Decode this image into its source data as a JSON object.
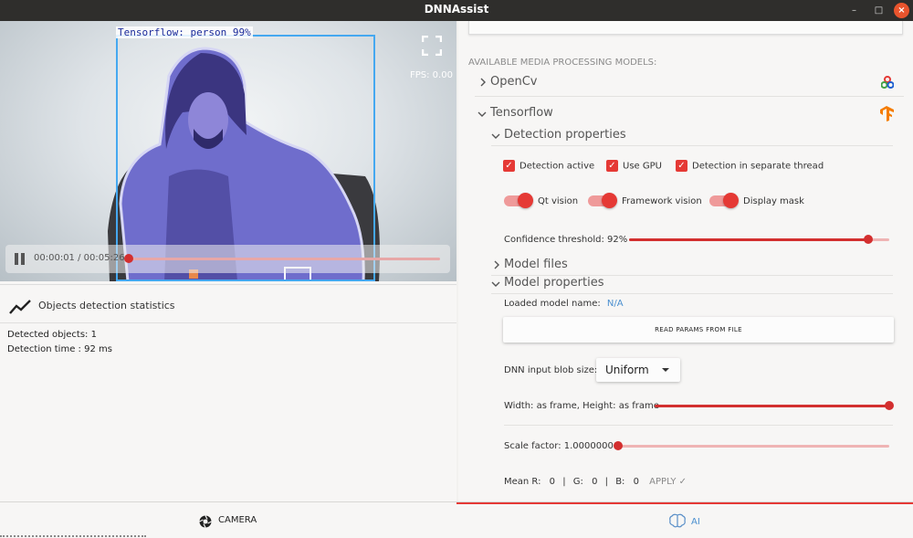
{
  "window": {
    "title": "DNNAssist",
    "minimize": "–",
    "maximize": "□",
    "close": "×"
  },
  "video": {
    "detection_label": "Tensorflow: person 99%",
    "fps": "FPS: 0.00",
    "time": "00:00:01 / 00:05:26",
    "progress_fraction": 0.0
  },
  "stats": {
    "title": "Objects detection statistics",
    "detected_objects": "Detected objects: 1",
    "detection_time": "Detection time  : 92 ms"
  },
  "models": {
    "section_title": "AVAILABLE MEDIA PROCESSING MODELS:",
    "opencv_label": "OpenCv",
    "tensorflow_label": "Tensorflow",
    "detection_properties_label": "Detection properties",
    "checkboxes": [
      "Detection active",
      "Use GPU",
      "Detection in separate thread"
    ],
    "toggles": [
      "Qt vision",
      "Framework vision",
      "Display mask"
    ],
    "confidence_label": "Confidence threshold: 92%",
    "confidence_value": 0.92,
    "model_files_label": "Model files",
    "model_properties_label": "Model properties",
    "loaded_model_label": "Loaded model name:",
    "loaded_model_value": "N/A",
    "read_params_button": "READ PARAMS FROM FILE",
    "blob_size_label": "DNN input blob size:",
    "blob_size_value": "Uniform",
    "width_height_label": "Width: as frame, Height: as frame",
    "width_height_value": 1.0,
    "scale_factor_label": "Scale factor: 1.00000000",
    "scale_factor_value": 0.0,
    "mean_r_label": "Mean R:",
    "mean_r": "0",
    "mean_g_label": "G:",
    "mean_g": "0",
    "mean_b_label": "B:",
    "mean_b": "0",
    "apply_label": "APPLY"
  },
  "tabs": {
    "camera": "CAMERA",
    "ai": "AI"
  },
  "colors": {
    "accent": "#e53935",
    "bbox": "#45a8f0",
    "link": "#4a8fcf"
  }
}
